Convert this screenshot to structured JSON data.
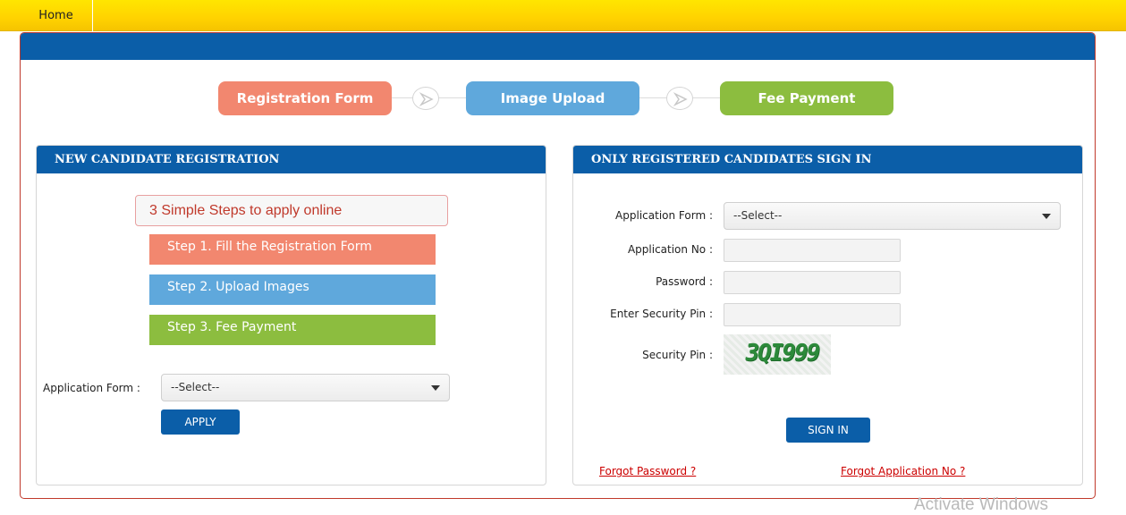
{
  "nav": {
    "home_label": "Home"
  },
  "progress": {
    "steps": [
      {
        "label": "Registration Form",
        "color": "#f2876f"
      },
      {
        "label": "Image Upload",
        "color": "#5fa8dc"
      },
      {
        "label": "Fee Payment",
        "color": "#8cbd3f"
      }
    ]
  },
  "new_registration": {
    "header": "NEW CANDIDATE REGISTRATION",
    "steps_title": "3 Simple Steps to apply online",
    "steps": [
      "Step 1. Fill the Registration Form",
      "Step 2. Upload Images",
      "Step 3. Fee Payment"
    ],
    "application_form_label": "Application Form :",
    "application_form_value": "--Select--",
    "apply_label": "APPLY"
  },
  "sign_in": {
    "header": "ONLY REGISTERED CANDIDATES SIGN IN",
    "application_form_label": "Application Form :",
    "application_form_value": "--Select--",
    "application_no_label": "Application No :",
    "password_label": "Password :",
    "enter_pin_label": "Enter Security Pin :",
    "security_pin_label": "Security Pin :",
    "captcha_text": "3QI999",
    "sign_in_label": "SIGN IN",
    "forgot_password": "Forgot Password ?",
    "forgot_application_no": "Forgot Application No ?"
  },
  "watermark": "Activate Windows",
  "colors": {
    "brand_blue": "#0b5ea8",
    "nav_yellow": "#ffd200",
    "link_red": "#cc0000"
  }
}
